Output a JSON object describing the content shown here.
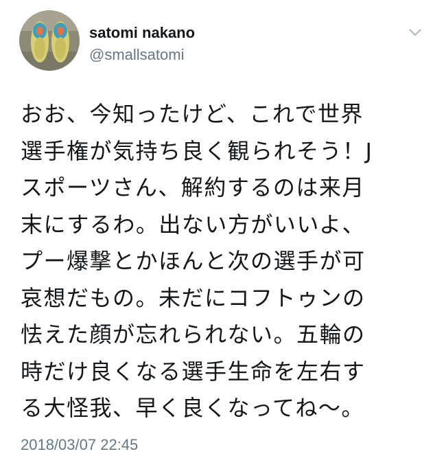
{
  "author": {
    "display_name": "satomi nakano",
    "handle": "@smallsatomi"
  },
  "icons": {
    "menu": "chevron-down-icon",
    "avatar": "avatar-photo"
  },
  "tweet": {
    "lines": [
      "おお、今知ったけど、これで世界",
      "選手権が気持ち良く観られそう！J",
      "スポーツさん、解約するのは来月",
      "末にするわ。出ない方がいいよ、",
      "プー爆撃とかほんと次の選手が可",
      "哀想だもの。未だにコフトゥンの",
      "怯えた顔が忘れられない。五輪の",
      "時だけ良くなる選手生命を左右す",
      "る大怪我、早く良くなってね〜。"
    ],
    "timestamp": "2018/03/07 22:45"
  },
  "colors": {
    "text": "#14171a",
    "secondary": "#657786",
    "background": "#ffffff"
  }
}
